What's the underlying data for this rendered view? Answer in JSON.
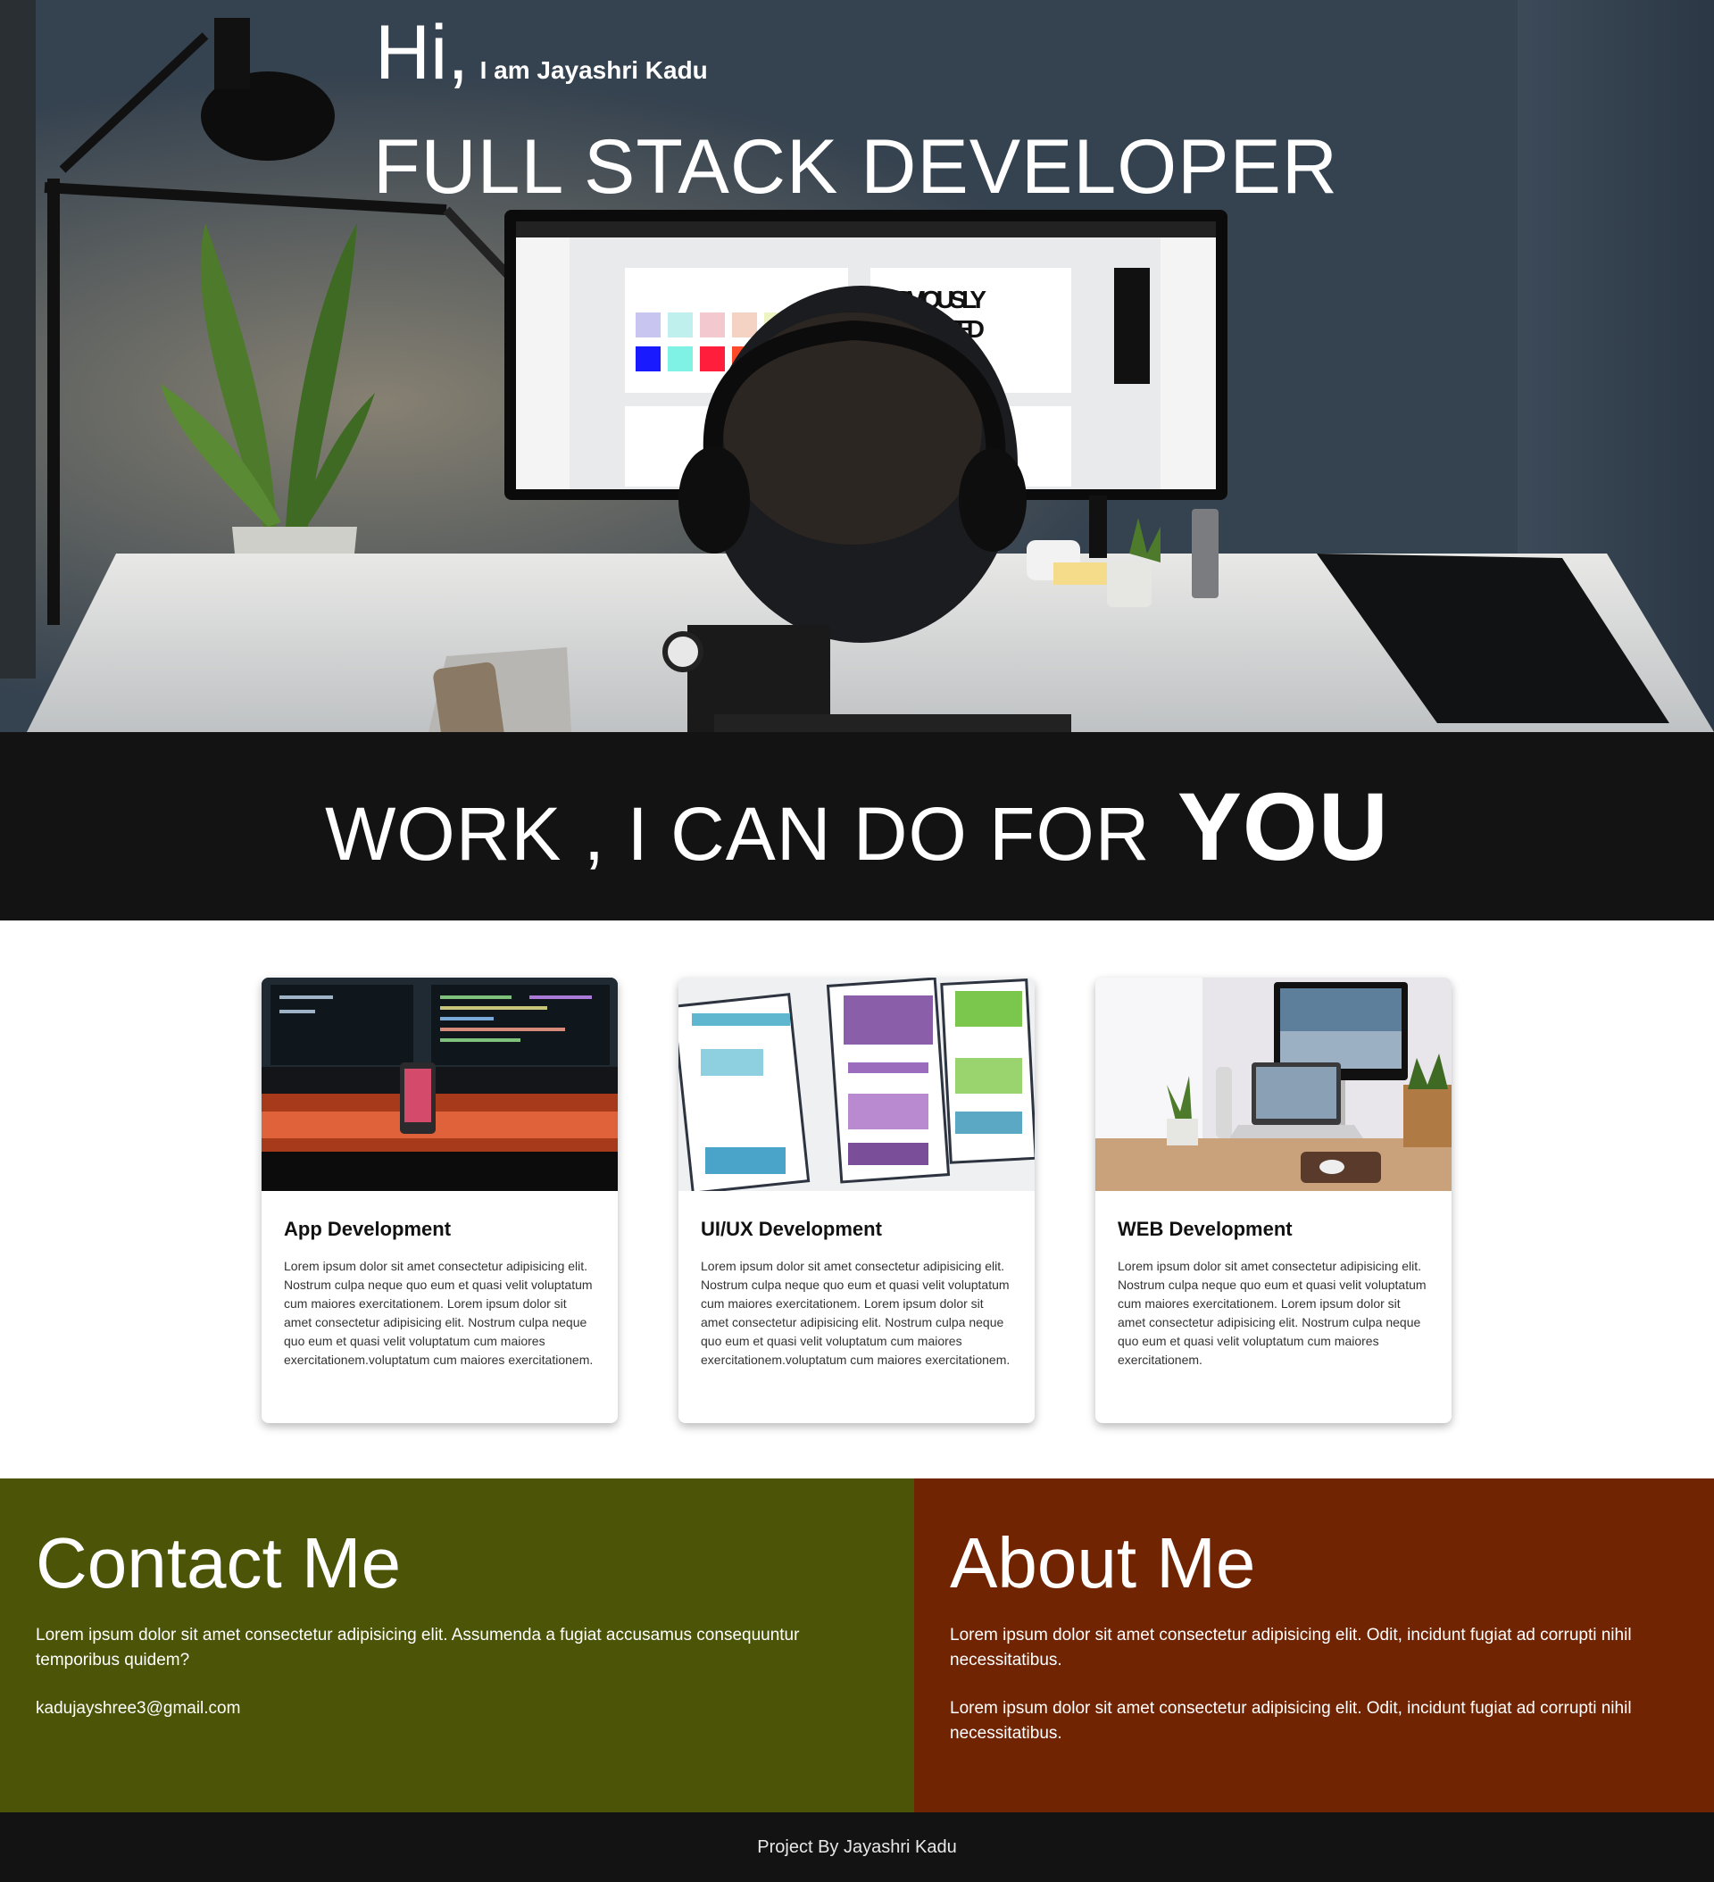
{
  "hero": {
    "hi": "Hi,",
    "name": "I am Jayashri Kadu",
    "title": "FULL STACK DEVELOPER",
    "monitor_text": "OBVIOUSLY CONDENSED"
  },
  "banner": {
    "text": "WORK , I CAN DO FOR",
    "emphasis": "YOU"
  },
  "services": [
    {
      "title": "App Development",
      "text": "Lorem ipsum dolor sit amet consectetur adipisicing elit. Nostrum culpa neque quo eum et quasi velit voluptatum cum maiores exercitationem. Lorem ipsum dolor sit amet consectetur adipisicing elit. Nostrum culpa neque quo eum et quasi velit voluptatum cum maiores exercitationem.voluptatum cum maiores exercitationem."
    },
    {
      "title": "UI/UX Development",
      "text": "Lorem ipsum dolor sit amet consectetur adipisicing elit. Nostrum culpa neque quo eum et quasi velit voluptatum cum maiores exercitationem. Lorem ipsum dolor sit amet consectetur adipisicing elit. Nostrum culpa neque quo eum et quasi velit voluptatum cum maiores exercitationem.voluptatum cum maiores exercitationem."
    },
    {
      "title": "WEB Development",
      "text": "Lorem ipsum dolor sit amet consectetur adipisicing elit. Nostrum culpa neque quo eum et quasi velit voluptatum cum maiores exercitationem. Lorem ipsum dolor sit amet consectetur adipisicing elit. Nostrum culpa neque quo eum et quasi velit voluptatum cum maiores exercitationem."
    }
  ],
  "contact": {
    "heading": "Contact Me",
    "text": "Lorem ipsum dolor sit amet consectetur adipisicing elit. Assumenda a fugiat accusamus consequuntur temporibus quidem?",
    "email": "kadujayshree3@gmail.com"
  },
  "about": {
    "heading": "About Me",
    "paragraphs": [
      "Lorem ipsum dolor sit amet consectetur adipisicing elit. Odit, incidunt fugiat ad corrupti nihil necessitatibus.",
      "Lorem ipsum dolor sit amet consectetur adipisicing elit. Odit, incidunt fugiat ad corrupti nihil necessitatibus."
    ]
  },
  "footer": {
    "text": "Project By Jayashri Kadu"
  },
  "colors": {
    "contact_bg": "#4c5407",
    "about_bg": "#712402",
    "dark_band": "#131313"
  }
}
